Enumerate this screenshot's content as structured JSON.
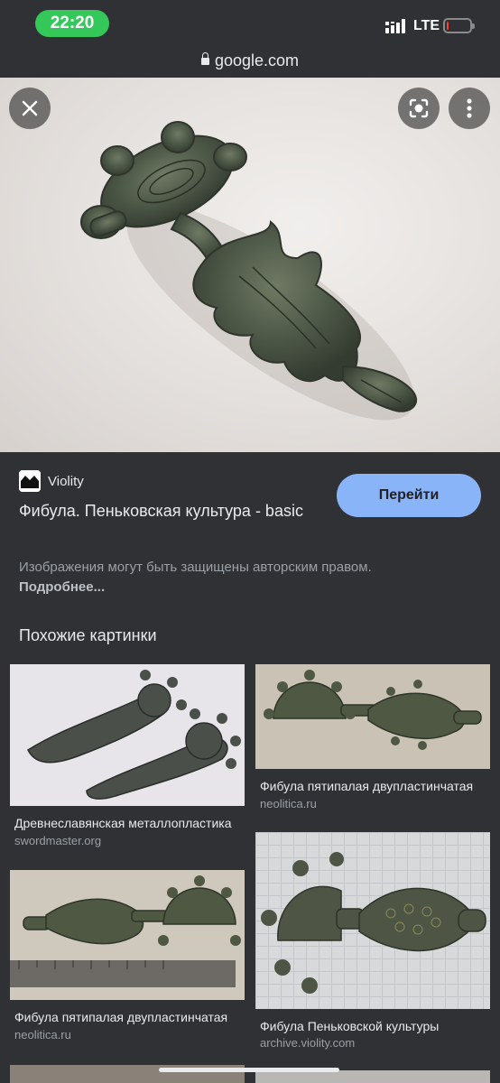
{
  "status_bar": {
    "time": "22:20",
    "network": "LTE",
    "battery_level": 0.1,
    "battery_color": "#ff3b30",
    "time_pill_color": "#34c759"
  },
  "browser": {
    "domain": "google.com",
    "lock_icon": "lock-icon"
  },
  "viewer": {
    "close_icon": "close-icon",
    "lens_icon": "lens-icon",
    "more_icon": "more-vert-icon"
  },
  "result": {
    "source": "Violity",
    "title": "Фибула. Пеньковская культура - basic",
    "go_button": "Перейти",
    "copyright_text": "Изображения могут быть защищены авторским правом.",
    "more_link": "Подробнее..."
  },
  "similar": {
    "heading": "Похожие картинки",
    "items": [
      {
        "caption": "Древнеславянская металлопластика",
        "domain": "swordmaster.org"
      },
      {
        "caption": "Фибула пятипалая двупластинчатая",
        "domain": "neolitica.ru"
      },
      {
        "caption": "Фибула пятипалая двупластинчатая",
        "domain": "neolitica.ru"
      },
      {
        "caption": "Фибула Пеньковской культуры",
        "domain": "archive.violity.com"
      }
    ]
  },
  "colors": {
    "background": "#303134",
    "accent_button": "#8ab4f8"
  }
}
